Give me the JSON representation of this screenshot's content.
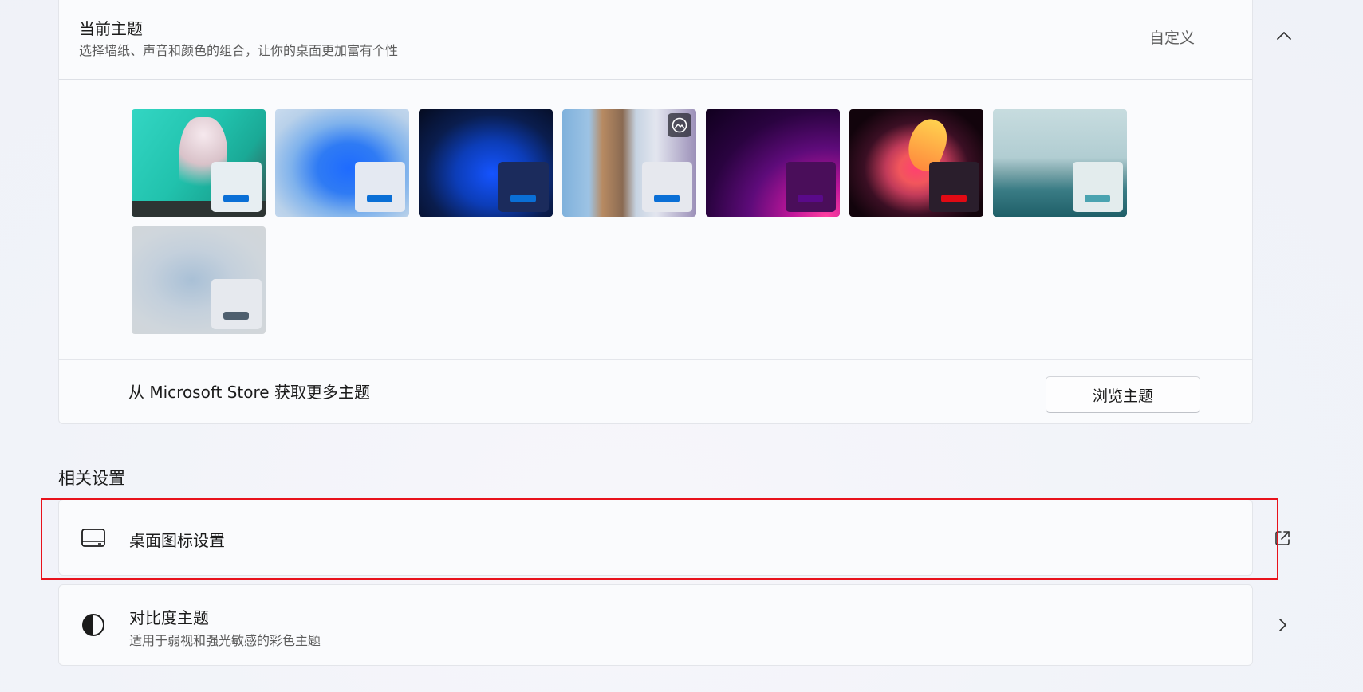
{
  "theme_section": {
    "title": "当前主题",
    "subtitle": "选择墙纸、声音和颜色的组合，让你的桌面更加富有个性",
    "current_value": "自定义",
    "expand_icon": "chevron-up-icon",
    "themes": [
      {
        "accent": "#0a6fd6",
        "window": "#e7eef2",
        "selected": true
      },
      {
        "accent": "#0a6fd6",
        "window": "#e4e9f2"
      },
      {
        "accent": "#0a6fd6",
        "window": "#1b2b5c"
      },
      {
        "accent": "#0a6fd6",
        "window": "#e6e8ee",
        "slideshow": true
      },
      {
        "accent": "#5a0a8a",
        "window": "#4a0e5a"
      },
      {
        "accent": "#e10a14",
        "window": "#2a1e2c"
      },
      {
        "accent": "#4aa3b0",
        "window": "#e3eced"
      },
      {
        "accent": "#4e5f6e",
        "window": "#e6e9ee"
      }
    ]
  },
  "store": {
    "label": "从 Microsoft Store 获取更多主题",
    "button": "浏览主题"
  },
  "related": {
    "heading": "相关设置",
    "desktop_icons": {
      "title": "桌面图标设置",
      "icon": "monitor-icon",
      "trailing_icon": "external-link-icon"
    },
    "contrast": {
      "title": "对比度主题",
      "subtitle": "适用于弱视和强光敏感的彩色主题",
      "icon": "contrast-icon",
      "trailing_icon": "chevron-right-icon"
    }
  },
  "colors": {
    "highlight": "#e8121c",
    "page_bg": "#f3f5fb",
    "card_bg": "#fafbfd"
  }
}
